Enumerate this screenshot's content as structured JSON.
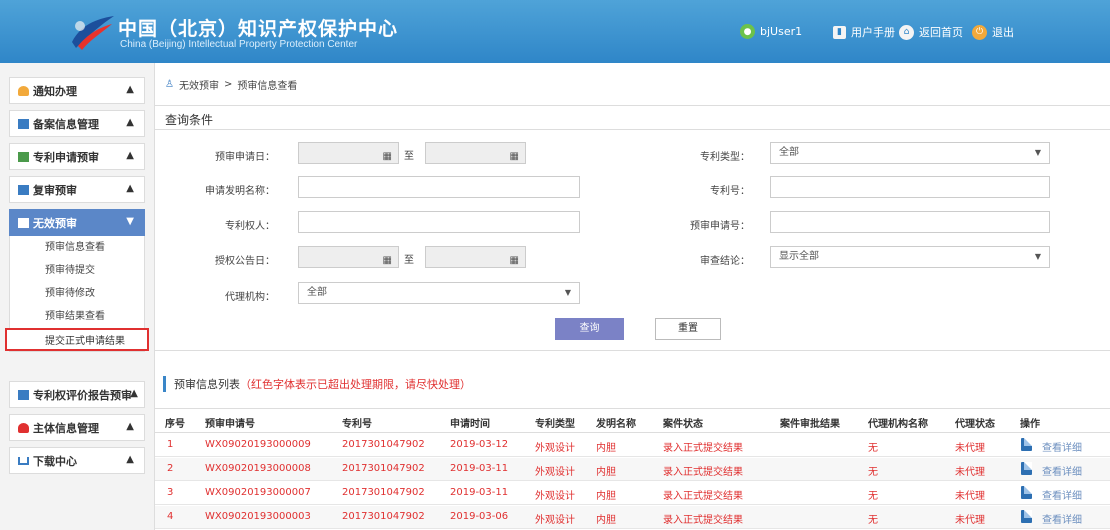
{
  "header": {
    "title_cn": "中国（北京）知识产权保护中心",
    "title_en": "China (Beijing) Intellectual Property Protection Center",
    "user": "bjUser1",
    "manual": "用户手册",
    "home": "返回首页",
    "logout": "退出"
  },
  "sidebar": {
    "menus": [
      {
        "label": "通知办理",
        "chev": "▲"
      },
      {
        "label": "备案信息管理",
        "chev": "▲"
      },
      {
        "label": "专利申请预审",
        "chev": "▲"
      },
      {
        "label": "复审预审",
        "chev": "▲"
      },
      {
        "label": "无效预审",
        "chev": "▼"
      },
      {
        "label": "专利权评价报告预审",
        "chev": "▲"
      },
      {
        "label": "主体信息管理",
        "chev": "▲"
      },
      {
        "label": "下载中心",
        "chev": "▲"
      }
    ],
    "subitems": [
      "预审信息查看",
      "预审待提交",
      "预审待修改",
      "预审结果查看",
      "提交正式申请结果"
    ]
  },
  "breadcrumb": {
    "parent": "无效预审",
    "sep": ">",
    "current": "预审信息查看"
  },
  "query": {
    "title": "查询条件",
    "labels": {
      "apply_date": "预审申请日：",
      "to1": "至",
      "patent_type": "专利类型：",
      "invention_name": "申请发明名称：",
      "patent_no": "专利号：",
      "patentee": "专利权人：",
      "pre_apply_no": "预审申请号：",
      "grant_date": "授权公告日：",
      "to2": "至",
      "conclusion": "审查结论：",
      "agency": "代理机构："
    },
    "values": {
      "patent_type": "全部",
      "conclusion": "显示全部",
      "agency": "全部"
    },
    "buttons": {
      "query": "查询",
      "reset": "重置"
    }
  },
  "list": {
    "title": "预审信息列表",
    "note": "（红色字体表示已超出处理期限，请尽快处理）",
    "columns": [
      "序号",
      "预审申请号",
      "专利号",
      "申请时间",
      "专利类型",
      "发明名称",
      "案件状态",
      "案件审批结果",
      "代理机构名称",
      "代理状态",
      "操作"
    ],
    "rows": [
      [
        "1",
        "WX09020193000009",
        "2017301047902",
        "2019-03-12",
        "外观设计",
        "内胆",
        "录入正式提交结果",
        "",
        "无",
        "未代理",
        "查看详细"
      ],
      [
        "2",
        "WX09020193000008",
        "2017301047902",
        "2019-03-11",
        "外观设计",
        "内胆",
        "录入正式提交结果",
        "",
        "无",
        "未代理",
        "查看详细"
      ],
      [
        "3",
        "WX09020193000007",
        "2017301047902",
        "2019-03-11",
        "外观设计",
        "内胆",
        "录入正式提交结果",
        "",
        "无",
        "未代理",
        "查看详细"
      ],
      [
        "4",
        "WX09020193000003",
        "2017301047902",
        "2019-03-06",
        "外观设计",
        "内胆",
        "录入正式提交结果",
        "",
        "无",
        "未代理",
        "查看详细"
      ]
    ]
  },
  "colors": {
    "header": "#2f86c8",
    "active_menu": "#5b87c8",
    "overdue": "#e03030",
    "query_button": "#7b82c6"
  }
}
